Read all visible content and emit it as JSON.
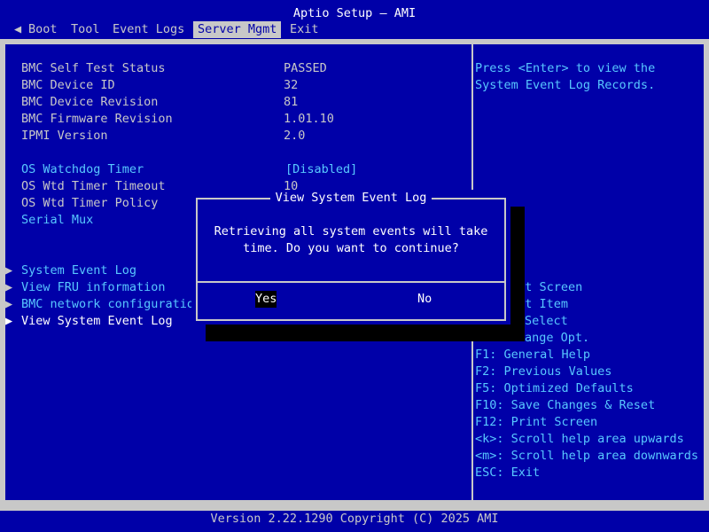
{
  "title": "Aptio Setup – AMI",
  "menu": {
    "left_arrow": "◀",
    "items": [
      {
        "label": "Boot"
      },
      {
        "label": "Tool"
      },
      {
        "label": "Event Logs"
      },
      {
        "label": "Server Mgmt",
        "active": true
      },
      {
        "label": "Exit"
      }
    ]
  },
  "settings": [
    {
      "label": "BMC Self Test Status",
      "value": "PASSED"
    },
    {
      "label": "BMC Device ID",
      "value": "32"
    },
    {
      "label": "BMC Device Revision",
      "value": "81"
    },
    {
      "label": "BMC Firmware Revision",
      "value": "1.01.10"
    },
    {
      "label": "IPMI Version",
      "value": "2.0"
    },
    {
      "label": "OS Watchdog Timer",
      "value": "[Disabled]"
    },
    {
      "label": "OS Wtd Timer Timeout",
      "value": "10"
    },
    {
      "label": "OS Wtd Timer Policy",
      "value": ""
    },
    {
      "label": "Serial Mux",
      "value": ""
    }
  ],
  "submenus": [
    {
      "label": "System Event Log"
    },
    {
      "label": "View FRU information"
    },
    {
      "label": "BMC network configuratio"
    },
    {
      "label": "View System Event Log"
    }
  ],
  "help": {
    "line1": "Press <Enter> to view the",
    "line2": "System Event Log Records."
  },
  "keys": [
    "ect Screen",
    "ect Item",
    "Select",
    "ange Opt.",
    "F1: General Help",
    "F2: Previous Values",
    "F5: Optimized Defaults",
    "F10: Save Changes & Reset",
    "F12: Print Screen",
    "<k>: Scroll help area upwards",
    "<m>: Scroll help area downwards",
    "ESC: Exit"
  ],
  "dialog": {
    "title": "View System Event Log",
    "message": "Retrieving all system events will take\ntime. Do you want to continue?",
    "yes_label": "Yes",
    "no_label": "No"
  },
  "footer": {
    "version": "Version 2.22.1290 Copyright (C) 2025 AMI"
  }
}
